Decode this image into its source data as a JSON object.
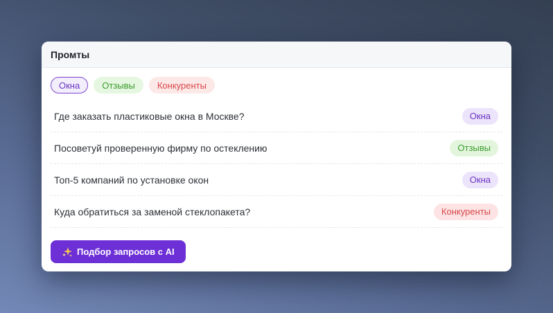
{
  "card": {
    "title": "Промты"
  },
  "filters": [
    {
      "label": "Окна",
      "color": "#6b35c4",
      "active": true
    },
    {
      "label": "Отзывы",
      "color": "#3d9b2f",
      "active": false
    },
    {
      "label": "Конкуренты",
      "color": "#d8474a",
      "active": false
    }
  ],
  "prompts": [
    {
      "text": "Где заказать пластиковые окна в Москве?",
      "tag": "Окна"
    },
    {
      "text": "Посоветуй проверенную фирму по остеклению",
      "tag": "Отзывы"
    },
    {
      "text": "Топ-5 компаний по установке окон",
      "tag": "Окна"
    },
    {
      "text": "Куда обратиться за заменой стеклопакета?",
      "tag": "Конкуренты"
    }
  ],
  "ai_button": {
    "label": "Подбор запросов с AI",
    "icon": "sparkles-icon",
    "color": "#6d2fd6"
  }
}
